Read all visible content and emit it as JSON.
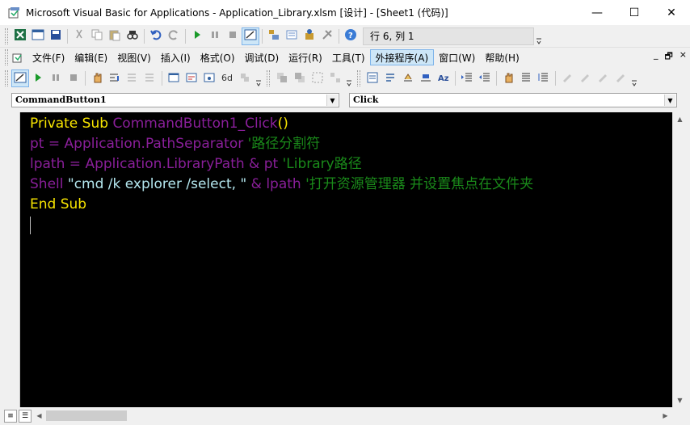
{
  "window": {
    "title": "Microsoft Visual Basic for Applications - Application_Library.xlsm [设计] - [Sheet1 (代码)]",
    "minimize_glyph": "—",
    "maximize_glyph": "☐",
    "close_glyph": "✕"
  },
  "toolbar": {
    "position_text": "行 6, 列 1"
  },
  "menu": {
    "items": [
      {
        "label": "文件(F)"
      },
      {
        "label": "编辑(E)"
      },
      {
        "label": "视图(V)"
      },
      {
        "label": "插入(I)"
      },
      {
        "label": "格式(O)"
      },
      {
        "label": "调试(D)"
      },
      {
        "label": "运行(R)"
      },
      {
        "label": "工具(T)"
      },
      {
        "label": "外接程序(A)"
      },
      {
        "label": "窗口(W)"
      },
      {
        "label": "帮助(H)"
      }
    ],
    "active_index": 8,
    "mdi_min": "_",
    "mdi_restore": "🗗",
    "mdi_close": "×"
  },
  "combos": {
    "object": "CommandButton1",
    "procedure": "Click"
  },
  "code": {
    "line1": {
      "kw": "Private Sub ",
      "name": "CommandButton1_Click",
      "paren": "()"
    },
    "line2": {
      "a": "pt",
      "b": " = ",
      "c": "Application",
      "d": ".",
      "e": "PathSeparator",
      "cmt": " '路径分割符"
    },
    "line3": {
      "a": "lpath",
      "b": " = ",
      "c": "Application",
      "d": ".",
      "e": "LibraryPath",
      "f": " & ",
      "g": "pt",
      "cmt": " 'Library路径"
    },
    "line4": {
      "a": "Shell ",
      "str": "\"cmd /k explorer /select, \"",
      "f": " & ",
      "g": "lpath",
      "cmt": " '打开资源管理器 并设置焦点在文件夹"
    },
    "line5": {
      "kw": "End Sub"
    }
  },
  "icons": [
    "excel-icon",
    "insert-userform-icon",
    "save-icon",
    "cut-icon",
    "copy-icon",
    "paste-icon",
    "find-icon",
    "undo-icon",
    "redo-icon",
    "run-icon",
    "break-icon",
    "reset-icon",
    "design-mode-icon",
    "project-explorer-icon",
    "properties-icon",
    "object-browser-icon",
    "toolbox-icon",
    "help-icon"
  ],
  "colors": {
    "code_bg": "#000000",
    "keyword": "#f7e400",
    "identifier": "#8a1f9a",
    "string": "#b5e8f0",
    "comment": "#1a8a1a"
  }
}
